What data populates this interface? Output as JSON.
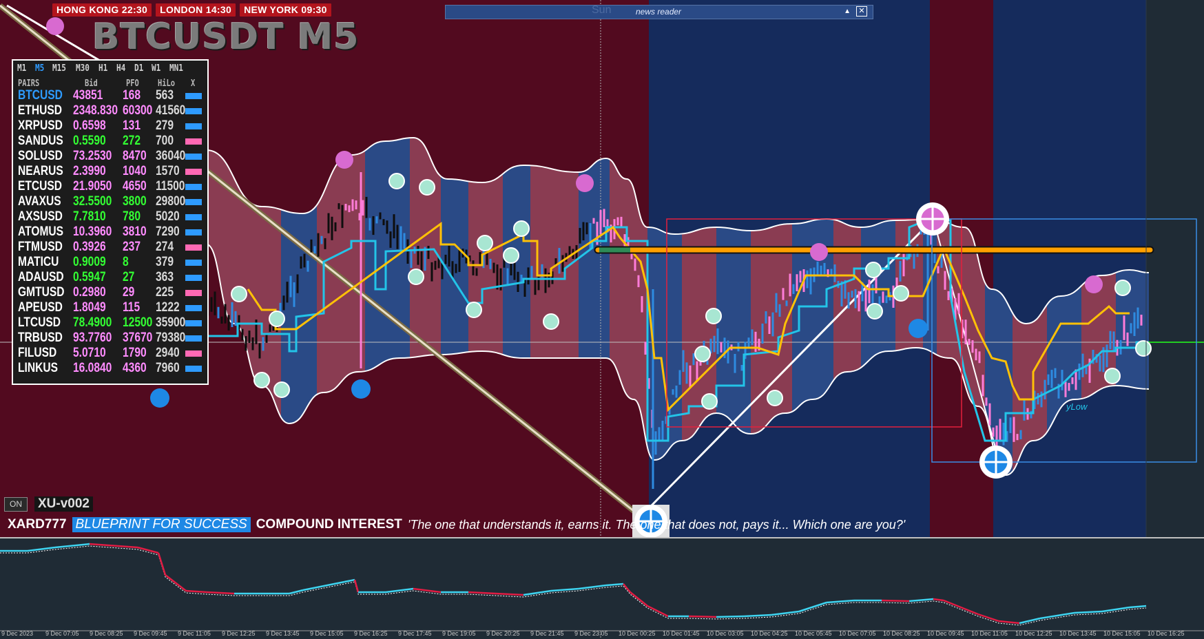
{
  "clocks": [
    {
      "city": "HONG KONG",
      "time": "22:30"
    },
    {
      "city": "LONDON",
      "time": "14:30"
    },
    {
      "city": "NEW YORK",
      "time": "09:30"
    }
  ],
  "clock_labels": [
    "HONG KONG 22:30",
    "LONDON  14:30",
    "NEW YORK 09:30"
  ],
  "symbol_title": "BTCUSDT M5",
  "news": {
    "bg_text": "Sun",
    "title": "news reader",
    "collapse_icon": "triangle-up-icon",
    "close_icon": "close-icon"
  },
  "pairs_panel": {
    "timeframes": [
      "M1",
      "M5",
      "M15",
      "M30",
      "H1",
      "H4",
      "D1",
      "W1",
      "MN1"
    ],
    "active_timeframe": "M5",
    "headers": {
      "pairs": "PAIRS",
      "bid": "Bid",
      "pfo": "PFO",
      "hilo": "HiLo",
      "x": "X"
    },
    "rows": [
      {
        "pair": "BTCUSD",
        "bid": "43851",
        "pfo": "168",
        "hilo": "563",
        "bid_color": "#ff8cff",
        "pair_color": "#2e9bff",
        "x_color": "#2e9bff"
      },
      {
        "pair": "ETHUSD",
        "bid": "2348.830",
        "pfo": "60300",
        "hilo": "41560",
        "bid_color": "#ff8cff",
        "pair_color": "#ffffff",
        "x_color": "#2e9bff"
      },
      {
        "pair": "XRPUSD",
        "bid": "0.6598",
        "pfo": "131",
        "hilo": "279",
        "bid_color": "#ff8cff",
        "pair_color": "#ffffff",
        "x_color": "#2e9bff"
      },
      {
        "pair": "SANDUS",
        "bid": "0.5590",
        "pfo": "272",
        "hilo": "700",
        "bid_color": "#33ff33",
        "pair_color": "#ffffff",
        "x_color": "#ff69b4"
      },
      {
        "pair": "SOLUSD",
        "bid": "73.2530",
        "pfo": "8470",
        "hilo": "36040",
        "bid_color": "#ff8cff",
        "pair_color": "#ffffff",
        "x_color": "#2e9bff"
      },
      {
        "pair": "NEARUS",
        "bid": "2.3990",
        "pfo": "1040",
        "hilo": "1570",
        "bid_color": "#ff8cff",
        "pair_color": "#ffffff",
        "x_color": "#ff69b4"
      },
      {
        "pair": "ETCUSD",
        "bid": "21.9050",
        "pfo": "4650",
        "hilo": "11500",
        "bid_color": "#ff8cff",
        "pair_color": "#ffffff",
        "x_color": "#2e9bff"
      },
      {
        "pair": "AVAXUS",
        "bid": "32.5500",
        "pfo": "3800",
        "hilo": "29800",
        "bid_color": "#33ff33",
        "pair_color": "#ffffff",
        "x_color": "#2e9bff"
      },
      {
        "pair": "AXSUSD",
        "bid": "7.7810",
        "pfo": "780",
        "hilo": "5020",
        "bid_color": "#33ff33",
        "pair_color": "#ffffff",
        "x_color": "#2e9bff"
      },
      {
        "pair": "ATOMUS",
        "bid": "10.3960",
        "pfo": "3810",
        "hilo": "7290",
        "bid_color": "#ff8cff",
        "pair_color": "#ffffff",
        "x_color": "#2e9bff"
      },
      {
        "pair": "FTMUSD",
        "bid": "0.3926",
        "pfo": "237",
        "hilo": "274",
        "bid_color": "#ff8cff",
        "pair_color": "#ffffff",
        "x_color": "#ff69b4"
      },
      {
        "pair": "MATICU",
        "bid": "0.9009",
        "pfo": "8",
        "hilo": "379",
        "bid_color": "#33ff33",
        "pair_color": "#ffffff",
        "x_color": "#2e9bff"
      },
      {
        "pair": "ADAUSD",
        "bid": "0.5947",
        "pfo": "27",
        "hilo": "363",
        "bid_color": "#33ff33",
        "pair_color": "#ffffff",
        "x_color": "#2e9bff"
      },
      {
        "pair": "GMTUSD",
        "bid": "0.2980",
        "pfo": "29",
        "hilo": "225",
        "bid_color": "#ff8cff",
        "pair_color": "#ffffff",
        "x_color": "#ff69b4"
      },
      {
        "pair": "APEUSD",
        "bid": "1.8049",
        "pfo": "115",
        "hilo": "1222",
        "bid_color": "#ff8cff",
        "pair_color": "#ffffff",
        "x_color": "#2e9bff"
      },
      {
        "pair": "LTCUSD",
        "bid": "78.4900",
        "pfo": "12500",
        "hilo": "35900",
        "bid_color": "#33ff33",
        "pair_color": "#ffffff",
        "x_color": "#2e9bff"
      },
      {
        "pair": "TRBUSD",
        "bid": "93.7760",
        "pfo": "37670",
        "hilo": "79380",
        "bid_color": "#ff8cff",
        "pair_color": "#ffffff",
        "x_color": "#2e9bff"
      },
      {
        "pair": "FILUSD",
        "bid": "5.0710",
        "pfo": "1790",
        "hilo": "2940",
        "bid_color": "#ff8cff",
        "pair_color": "#ffffff",
        "x_color": "#ff69b4"
      },
      {
        "pair": "LINKUS",
        "bid": "16.0840",
        "pfo": "4360",
        "hilo": "7960",
        "bid_color": "#ff8cff",
        "pair_color": "#ffffff",
        "x_color": "#2e9bff"
      }
    ]
  },
  "on_button": "ON",
  "version": "XU-v002",
  "banner": {
    "name": "XARD777",
    "tag": "BLUEPRINT FOR SUCCESS",
    "title": "COMPOUND INTEREST",
    "quote": "'The one that understands it, earns it. The one that does not, pays it... Which one are you?'"
  },
  "low_label": "yLow",
  "time_axis": [
    "9 Dec 2023",
    "9 Dec 07:05",
    "9 Dec 08:25",
    "9 Dec 09:45",
    "9 Dec 11:05",
    "9 Dec 12:25",
    "9 Dec 13:45",
    "9 Dec 15:05",
    "9 Dec 16:25",
    "9 Dec 17:45",
    "9 Dec 19:05",
    "9 Dec 20:25",
    "9 Dec 21:45",
    "9 Dec 23:05",
    "10 Dec 00:25",
    "10 Dec 01:45",
    "10 Dec 03:05",
    "10 Dec 04:25",
    "10 Dec 05:45",
    "10 Dec 07:05",
    "10 Dec 08:25",
    "10 Dec 09:45",
    "10 Dec 11:05",
    "10 Dec 12:25",
    "10 Dec 13:45",
    "10 Dec 15:05",
    "10 Dec 16:25"
  ],
  "colors": {
    "session_maroon": "#520a1f",
    "session_navy": "#152b5c",
    "band_blue": "#2a4a86",
    "band_red": "#8a3c52",
    "up_candle": "#2e8be0",
    "down_candle": "#ff7cd8",
    "signal_line_yellow": "#ffc107",
    "signal_line_cyan": "#23c4e8",
    "resistance_orange": "#ffa000",
    "sub_red": "#e01c43",
    "sub_cyan": "#3ed4f0"
  }
}
